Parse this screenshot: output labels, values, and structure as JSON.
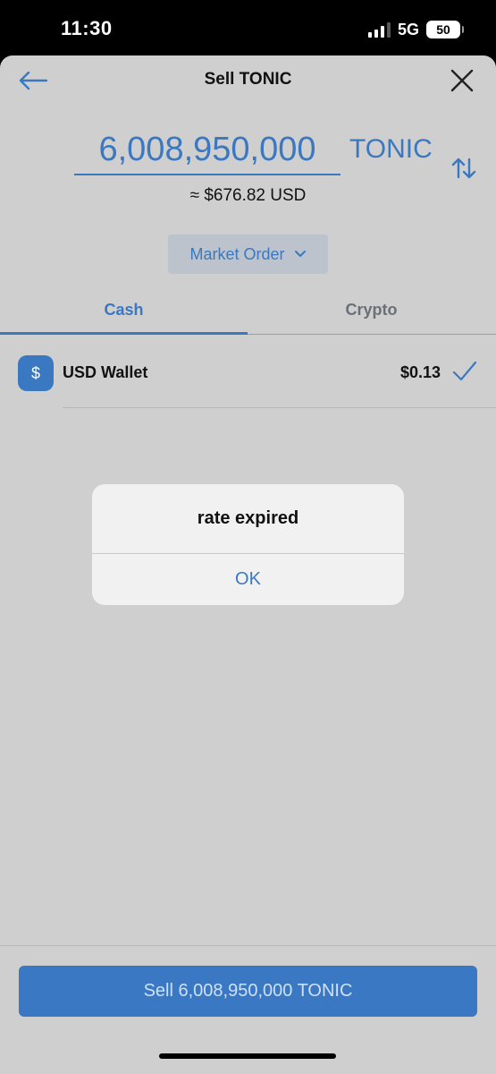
{
  "status_bar": {
    "time": "11:30",
    "network": "5G",
    "battery": "50"
  },
  "nav": {
    "title": "Sell TONIC",
    "back_icon": "arrow-left-icon",
    "close_icon": "close-icon"
  },
  "amount": {
    "value": "6,008,950,000",
    "currency": "TONIC",
    "usd_equivalent": "≈ $676.82 USD",
    "swap_icon": "swap-vertical-icon"
  },
  "order_type": {
    "label": "Market Order",
    "icon": "chevron-down-icon"
  },
  "tabs": [
    {
      "label": "Cash",
      "active": true
    },
    {
      "label": "Crypto",
      "active": false
    }
  ],
  "wallet": {
    "icon_symbol": "$",
    "name": "USD Wallet",
    "balance": "$0.13",
    "selected_icon": "checkmark-icon"
  },
  "dialog": {
    "message": "rate expired",
    "ok_label": "OK"
  },
  "footer": {
    "sell_label": "Sell 6,008,950,000 TONIC"
  },
  "colors": {
    "accent": "#3a79c2",
    "sheet_background": "#cfcfcf",
    "dialog_background": "#f1f1f1"
  }
}
